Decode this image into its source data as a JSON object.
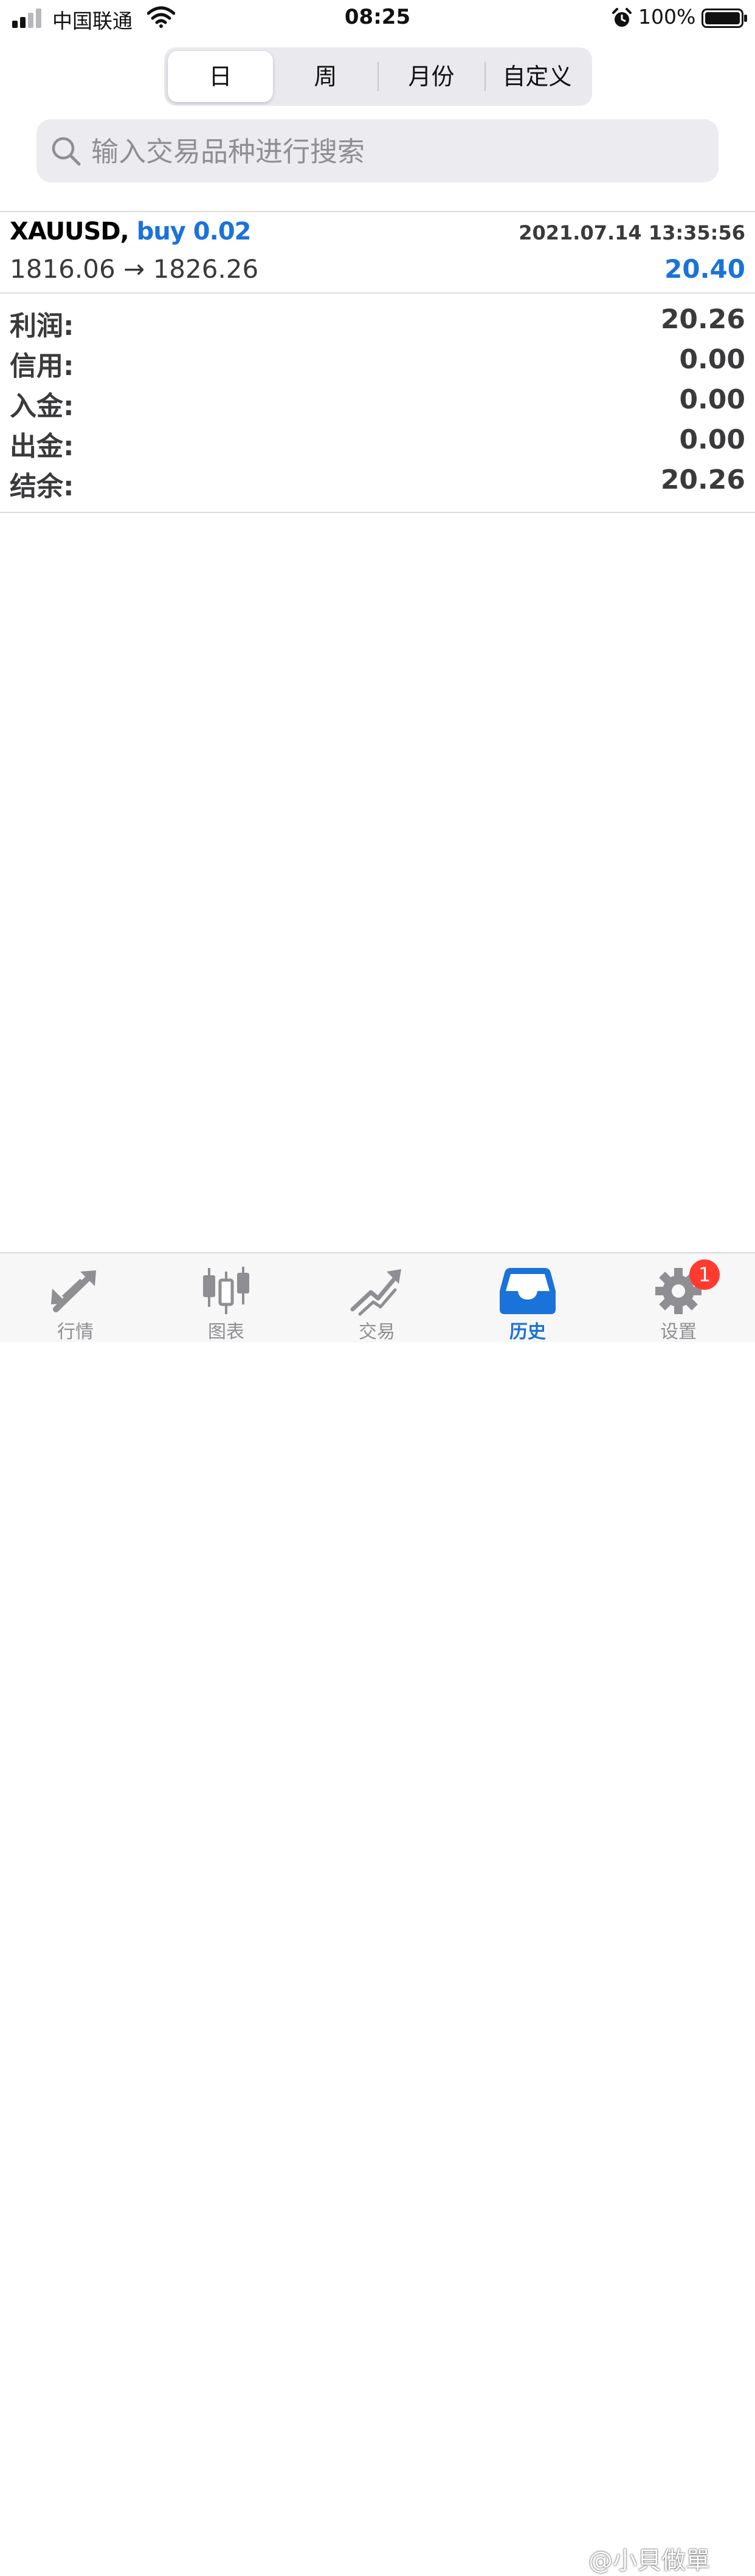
{
  "status_bar": {
    "carrier": "中国联通",
    "time": "08:25",
    "battery": "100%"
  },
  "segments": [
    {
      "label": "日",
      "active": true
    },
    {
      "label": "周",
      "active": false
    },
    {
      "label": "月份",
      "active": false
    },
    {
      "label": "自定义",
      "active": false
    }
  ],
  "search": {
    "placeholder": "输入交易品种进行搜索",
    "icon": "search-icon"
  },
  "trade": {
    "symbol": "XAUUSD",
    "separator": ",",
    "side": "buy 0.02",
    "time": "2021.07.14 13:35:56",
    "prices": "1816.06 → 1826.26",
    "profit": "20.40"
  },
  "summary": [
    {
      "label": "利润:",
      "value": "20.26"
    },
    {
      "label": "信用:",
      "value": "0.00"
    },
    {
      "label": "入金:",
      "value": "0.00"
    },
    {
      "label": "出金:",
      "value": "0.00"
    },
    {
      "label": "结余:",
      "value": "20.26"
    }
  ],
  "tabs": [
    {
      "label": "行情",
      "icon": "quotes-arrows-icon",
      "active": false
    },
    {
      "label": "图表",
      "icon": "candlestick-chart-icon",
      "active": false
    },
    {
      "label": "交易",
      "icon": "trade-trend-icon",
      "active": false
    },
    {
      "label": "历史",
      "icon": "history-tray-icon",
      "active": true
    },
    {
      "label": "设置",
      "icon": "gear-icon",
      "active": false,
      "badge": "1"
    }
  ],
  "watermark": "@小貝做單",
  "colors": {
    "accent": "#1a73d9",
    "badge": "#ff3b30",
    "text_secondary": "#3a3a3c",
    "icon_inactive": "#8e8e93"
  }
}
